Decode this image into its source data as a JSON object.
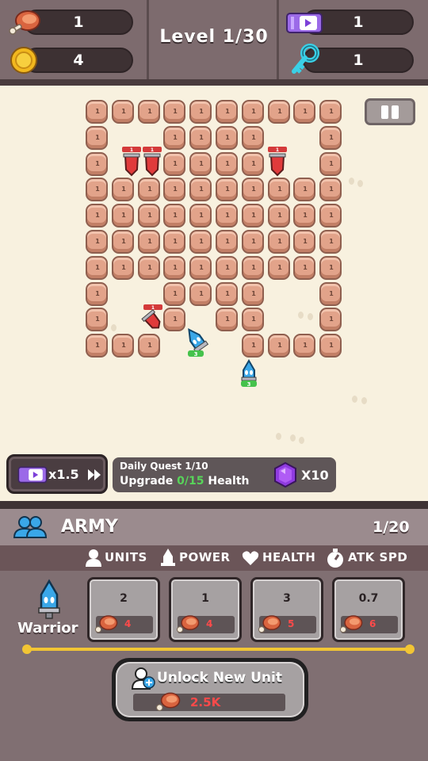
{
  "hud": {
    "meat_count": "1",
    "coin_count": "4",
    "level_text": "Level 1/30",
    "ticket_count": "1",
    "key_count": "1"
  },
  "board": {
    "brick_value": "1",
    "enemy_level": "1",
    "warrior_level": "3"
  },
  "boost": {
    "multiplier": "x1.5"
  },
  "quest": {
    "title": "Daily Quest 1/10",
    "action": "Upgrade",
    "progress_current": "0",
    "progress_total": "/15",
    "target": "Health",
    "reward": "X10"
  },
  "army": {
    "title": "ARMY",
    "count": "1/20",
    "headers": [
      "UNITS",
      "POWER",
      "HEALTH",
      "ATK SPD"
    ],
    "unit_name": "Warrior",
    "cards": [
      {
        "value": "2",
        "cost": "4"
      },
      {
        "value": "1",
        "cost": "4"
      },
      {
        "value": "3",
        "cost": "5"
      },
      {
        "value": "0.7",
        "cost": "6"
      }
    ],
    "unlock_label": "Unlock New Unit",
    "unlock_cost": "2.5K"
  },
  "colors": {
    "frame": "#7d6b6e",
    "board": "#f8f1df",
    "brick": "#e2a38a",
    "accent_gold": "#f2c534",
    "cost_red": "#ff4a4a",
    "progress_green": "#58d35a"
  },
  "icons": [
    "meat-icon",
    "coin-icon",
    "video-ticket-icon",
    "key-icon",
    "pause-icon",
    "fast-forward-icon",
    "gem-icon",
    "army-icon",
    "person-icon",
    "power-icon",
    "heart-icon",
    "speed-icon",
    "warrior-icon",
    "add-user-icon"
  ]
}
